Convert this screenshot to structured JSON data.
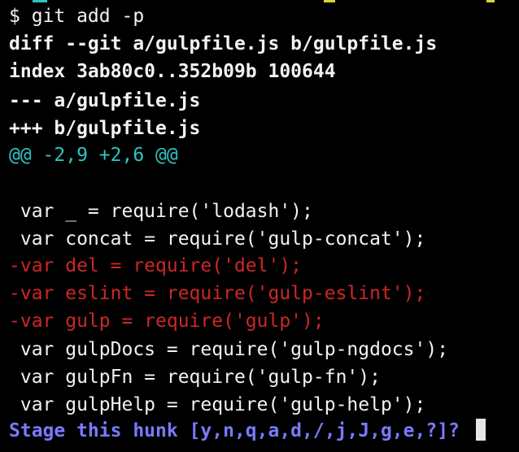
{
  "terminal": {
    "lines": [
      {
        "text": "$ git add -p",
        "style": "normal"
      },
      {
        "text": "diff --git a/gulpfile.js b/gulpfile.js",
        "style": "bold"
      },
      {
        "text": "index 3ab80c0..352b09b 100644",
        "style": "bold"
      },
      {
        "text": "--- a/gulpfile.js",
        "style": "bold"
      },
      {
        "text": "+++ b/gulpfile.js",
        "style": "bold"
      },
      {
        "text": "@@ -2,9 +2,6 @@",
        "style": "hunk"
      },
      {
        "text": "",
        "style": "normal"
      },
      {
        "text": " var _ = require('lodash');",
        "style": "normal"
      },
      {
        "text": " var concat = require('gulp-concat');",
        "style": "normal"
      },
      {
        "text": "-var del = require('del');",
        "style": "removed"
      },
      {
        "text": "-var eslint = require('gulp-eslint');",
        "style": "removed"
      },
      {
        "text": "-var gulp = require('gulp');",
        "style": "removed"
      },
      {
        "text": " var gulpDocs = require('gulp-ngdocs');",
        "style": "normal"
      },
      {
        "text": " var gulpFn = require('gulp-fn');",
        "style": "normal"
      },
      {
        "text": " var gulpHelp = require('gulp-help');",
        "style": "normal"
      }
    ],
    "prompt": "Stage this hunk [y,n,q,a,d,/,j,J,g,e,?]?"
  },
  "colors": {
    "background": "#000000",
    "text": "#eaeaea",
    "hunk_header": "#2ec4c4",
    "removed": "#cc2727",
    "prompt": "#7a7aff",
    "cursor": "#e6e6e6"
  }
}
